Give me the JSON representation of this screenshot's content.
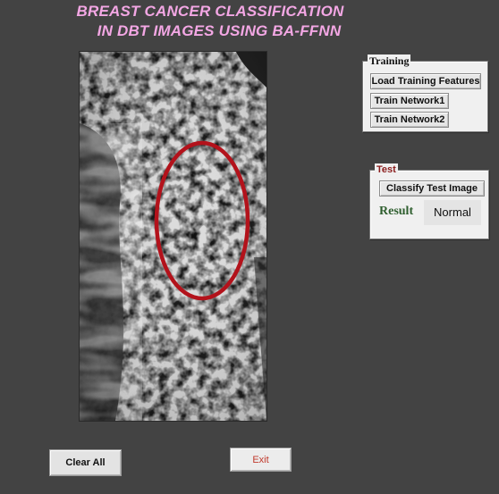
{
  "title": {
    "line1": "BREAST CANCER CLASSIFICATION",
    "line2": "IN DBT IMAGES USING BA-FFNN"
  },
  "colors": {
    "background": "#434343",
    "title": "#f3a7e4",
    "panel": "#f0f0f0",
    "result_label": "#2e5e2e",
    "exit_text": "#c0392b",
    "roi_ellipse": "#b3121b"
  },
  "image": {
    "description_icon": "mammogram-image",
    "roi_marker": "red-ellipse-outline"
  },
  "training": {
    "legend": "Training",
    "buttons": {
      "load_features": "Load Training Features",
      "train_network1": "Train Network1",
      "train_network2": "Train Network2"
    }
  },
  "test": {
    "legend": "Test",
    "classify_button": "Classify Test Image",
    "result_label": "Result",
    "result_value": "Normal"
  },
  "footer": {
    "clear_all": "Clear All",
    "exit": "Exit"
  }
}
